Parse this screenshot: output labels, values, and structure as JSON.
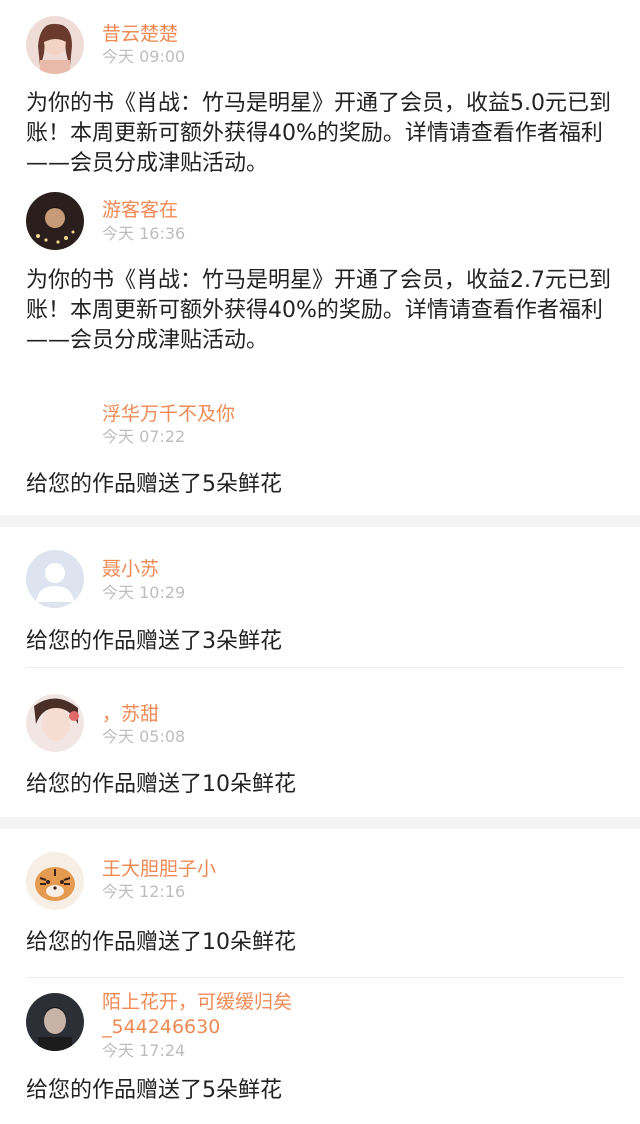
{
  "messages": [
    {
      "user": "昔云楚楚",
      "time": "今天 09:00",
      "text": "为你的书《肖战：竹马是明星》开通了会员，收益5.0元已到账！本周更新可额外获得40%的奖励。详情请查看作者福利——会员分成津贴活动。"
    },
    {
      "user": "游客客在",
      "time": "今天 16:36",
      "text": "为你的书《肖战：竹马是明星》开通了会员，收益2.7元已到账！本周更新可额外获得40%的奖励。详情请查看作者福利——会员分成津贴活动。"
    },
    {
      "user": "浮华万千不及你",
      "time": "今天 07:22",
      "text": "给您的作品赠送了5朵鲜花"
    },
    {
      "user": "聂小苏",
      "time": "今天 10:29",
      "text": "给您的作品赠送了3朵鲜花"
    },
    {
      "user": "，苏甜",
      "time": "今天 05:08",
      "text": "给您的作品赠送了10朵鲜花"
    },
    {
      "user": "王大胆胆子小",
      "time": "今天 12:16",
      "text": "给您的作品赠送了10朵鲜花"
    },
    {
      "user": "陌上花开，可缓缓归矣",
      "user_line2": "_544246630",
      "time": "今天 17:24",
      "text": "给您的作品赠送了5朵鲜花"
    }
  ],
  "colors": {
    "name": "#f08a55",
    "time": "#bdbdbd",
    "text": "#222222",
    "divider": "#ececec",
    "section_gap": "#f4f4f4"
  }
}
